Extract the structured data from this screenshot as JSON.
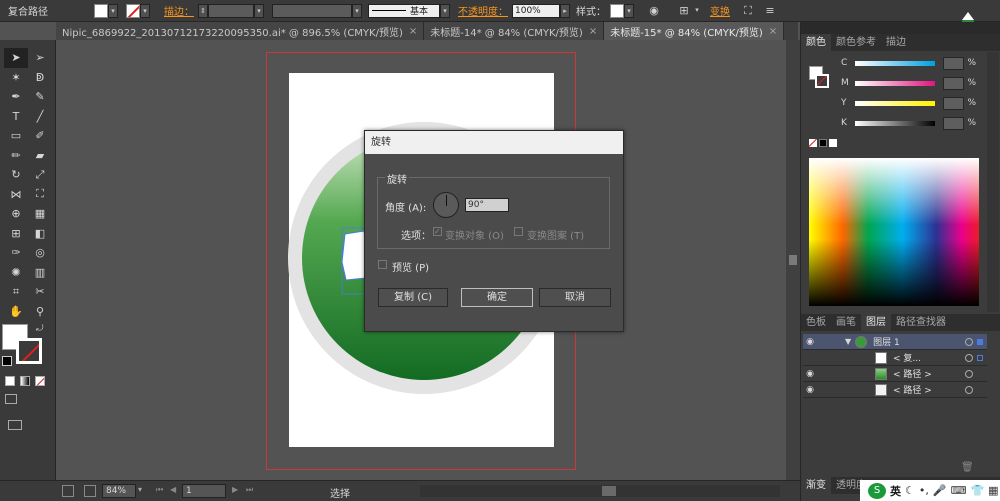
{
  "control_bar": {
    "object_type": "复合路径",
    "stroke_link": "描边：",
    "stroke_style": "基本",
    "opacity_link": "不透明度：",
    "opacity_value": "100%",
    "style_label": "样式：",
    "transform_link": "变换"
  },
  "tabs": [
    {
      "label": "Nipic_6869922_20130712173220095350.ai* @ 896.5% (CMYK/预览)",
      "active": false
    },
    {
      "label": "未标题-14* @ 84% (CMYK/预览)",
      "active": false
    },
    {
      "label": "未标题-15* @ 84% (CMYK/预览)",
      "active": true
    }
  ],
  "dialog": {
    "title": "旋转",
    "group_label": "旋转",
    "angle_label": "角度 (A):",
    "angle_value": "90°",
    "options_label": "选项：",
    "transform_objects": "变换对象 (O)",
    "transform_patterns": "变换图案 (T)",
    "preview": "预览 (P)",
    "copy_button": "复制 (C)",
    "ok_button": "确定",
    "cancel_button": "取消"
  },
  "color_panel": {
    "tabs": [
      "颜色",
      "颜色参考",
      "描边"
    ],
    "channels": [
      {
        "label": "C",
        "gradient": [
          "#ffffff",
          "#00a0e0"
        ]
      },
      {
        "label": "M",
        "gradient": [
          "#ffffff",
          "#e0157f"
        ]
      },
      {
        "label": "Y",
        "gradient": [
          "#ffffff",
          "#fff200"
        ]
      },
      {
        "label": "K",
        "gradient": [
          "#ffffff",
          "#000000"
        ]
      }
    ],
    "percent": "%"
  },
  "layers_panel": {
    "tabs": [
      "色板",
      "画笔",
      "图层",
      "路径查找器"
    ],
    "rows": [
      {
        "name": "图层 1",
        "thumb": "#3a9a3a"
      },
      {
        "name": "< 复...",
        "thumb": "#ffffff"
      },
      {
        "name": "< 路径 >",
        "thumb": "#4aa84a"
      },
      {
        "name": "< 路径 >",
        "thumb": "#f2f2f2"
      }
    ]
  },
  "bottom_panel_tabs": [
    "渐变",
    "透明度"
  ],
  "status_bar": {
    "zoom": "84%",
    "page": "1",
    "tool": "选择"
  },
  "taskbar": {
    "ime": "英"
  },
  "colors": {
    "accent_orange": "#f7941d",
    "artboard_border": "#c83a3a",
    "circle_green": "#2e8b2e"
  }
}
